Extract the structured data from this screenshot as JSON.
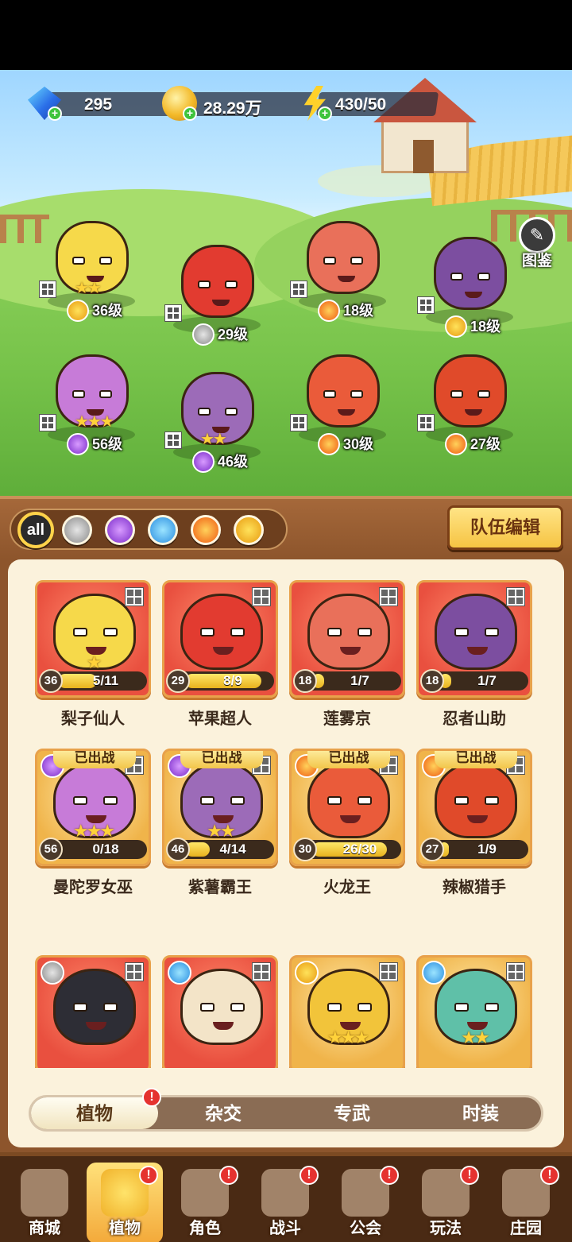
{
  "currency": {
    "gems": "295",
    "coins": "28.29万",
    "energy": "430/50"
  },
  "guide": {
    "label": "图鉴"
  },
  "team_heroes": [
    {
      "level": "36级",
      "element": "thunder",
      "stars": "★★",
      "body": "#f6d94a"
    },
    {
      "level": "29级",
      "element": "steel",
      "stars": "",
      "body": "#e23b30"
    },
    {
      "level": "18级",
      "element": "fire",
      "stars": "",
      "body": "#e9705a"
    },
    {
      "level": "18级",
      "element": "thunder",
      "stars": "",
      "body": "#7c4ea0"
    },
    {
      "level": "56级",
      "element": "poison",
      "stars": "★★★",
      "body": "#c77bd8"
    },
    {
      "level": "46级",
      "element": "poison",
      "stars": "★★",
      "body": "#9c6bb8"
    },
    {
      "level": "30级",
      "element": "fire",
      "stars": "",
      "body": "#ea5b3a"
    },
    {
      "level": "27级",
      "element": "fire",
      "stars": "",
      "body": "#e04a2a"
    }
  ],
  "filters": {
    "all_label": "all",
    "elements": [
      "steel",
      "poison",
      "water",
      "fire",
      "thunder"
    ]
  },
  "team_edit_label": "队伍编辑",
  "cards": [
    {
      "name": "梨子仙人",
      "level": "36",
      "fragments": "5/11",
      "progress": 0.45,
      "stars": "★",
      "deployed": "",
      "style": "red",
      "element": "",
      "body": "#f6d94a"
    },
    {
      "name": "苹果超人",
      "level": "29",
      "fragments": "8/9",
      "progress": 0.89,
      "stars": "",
      "deployed": "",
      "style": "red",
      "element": "",
      "body": "#e23b30"
    },
    {
      "name": "莲雾京",
      "level": "18",
      "fragments": "1/7",
      "progress": 0.14,
      "stars": "",
      "deployed": "",
      "style": "red",
      "element": "",
      "body": "#e9705a"
    },
    {
      "name": "忍者山助",
      "level": "18",
      "fragments": "1/7",
      "progress": 0.14,
      "stars": "",
      "deployed": "",
      "style": "red",
      "element": "",
      "body": "#7c4ea0"
    },
    {
      "name": "曼陀罗女巫",
      "level": "56",
      "fragments": "0/18",
      "progress": 0.0,
      "stars": "★★★",
      "deployed": "已出战",
      "style": "gold",
      "element": "poison",
      "body": "#c77bd8"
    },
    {
      "name": "紫薯霸王",
      "level": "46",
      "fragments": "4/14",
      "progress": 0.29,
      "stars": "★★",
      "deployed": "已出战",
      "style": "gold",
      "element": "poison",
      "body": "#9c6bb8"
    },
    {
      "name": "火龙王",
      "level": "30",
      "fragments": "26/30",
      "progress": 0.87,
      "stars": "",
      "deployed": "已出战",
      "style": "gold",
      "element": "fire",
      "body": "#ea5b3a"
    },
    {
      "name": "辣椒猎手",
      "level": "27",
      "fragments": "1/9",
      "progress": 0.11,
      "stars": "",
      "deployed": "已出战",
      "style": "gold",
      "element": "fire",
      "body": "#e04a2a"
    },
    {
      "name": "",
      "level": "",
      "fragments": "",
      "progress": 0,
      "stars": "",
      "deployed": "",
      "style": "red",
      "element": "steel",
      "body": "#2d2d35"
    },
    {
      "name": "",
      "level": "",
      "fragments": "",
      "progress": 0,
      "stars": "",
      "deployed": "",
      "style": "red",
      "element": "water",
      "body": "#f3e4c8"
    },
    {
      "name": "",
      "level": "",
      "fragments": "",
      "progress": 0,
      "stars": "★★★",
      "deployed": "",
      "style": "gold",
      "element": "thunder",
      "body": "#f2c43a"
    },
    {
      "name": "",
      "level": "",
      "fragments": "",
      "progress": 0,
      "stars": "★★",
      "deployed": "",
      "style": "gold",
      "element": "water",
      "body": "#5fc0a8"
    }
  ],
  "segments": [
    "植物",
    "杂交",
    "专武",
    "时装"
  ],
  "segment_badge": "!",
  "nav": [
    {
      "label": "商城",
      "badge": ""
    },
    {
      "label": "植物",
      "badge": "!"
    },
    {
      "label": "角色",
      "badge": "!"
    },
    {
      "label": "战斗",
      "badge": "!"
    },
    {
      "label": "公会",
      "badge": "!"
    },
    {
      "label": "玩法",
      "badge": "!"
    },
    {
      "label": "庄园",
      "badge": "!"
    }
  ]
}
